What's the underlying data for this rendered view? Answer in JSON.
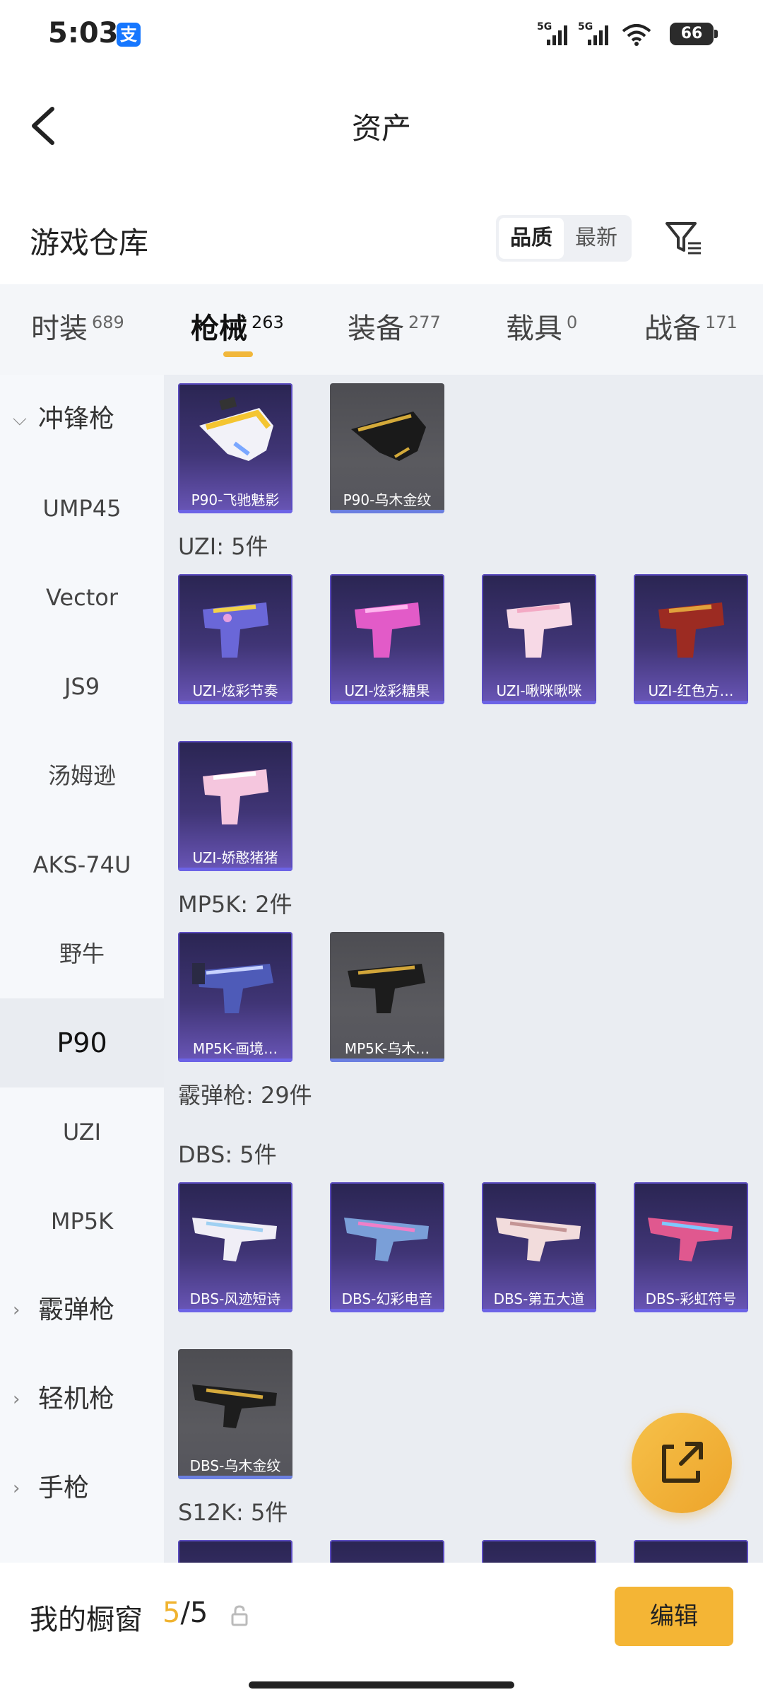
{
  "status": {
    "time": "5:03",
    "alipay_glyph": "支",
    "net1": "5G",
    "net2": "5G",
    "battery": "66"
  },
  "header": {
    "title": "资产"
  },
  "warehouse": {
    "title": "游戏仓库",
    "sort": [
      "品质",
      "最新"
    ],
    "active_sort": 0
  },
  "tabs": [
    {
      "label": "时装",
      "count": "689"
    },
    {
      "label": "枪械",
      "count": "263",
      "active": true
    },
    {
      "label": "装备",
      "count": "277"
    },
    {
      "label": "载具",
      "count": "0"
    },
    {
      "label": "战备",
      "count": "171"
    }
  ],
  "sidebar": [
    {
      "label": "冲锋枪",
      "group": true,
      "chevron": "down"
    },
    {
      "label": "UMP45"
    },
    {
      "label": "Vector"
    },
    {
      "label": "JS9"
    },
    {
      "label": "汤姆逊"
    },
    {
      "label": "AKS-74U"
    },
    {
      "label": "野牛"
    },
    {
      "label": "P90",
      "selected": true
    },
    {
      "label": "UZI"
    },
    {
      "label": "MP5K"
    },
    {
      "label": "霰弹枪",
      "group": true,
      "chevron": "right"
    },
    {
      "label": "轻机枪",
      "group": true,
      "chevron": "right"
    },
    {
      "label": "手枪",
      "group": true,
      "chevron": "right"
    }
  ],
  "sections": {
    "uzi": "UZI: 5件",
    "mp5k": "MP5K: 2件",
    "shotgun": "霰弹枪: 29件",
    "dbs": "DBS: 5件",
    "s12k": "S12K: 5件"
  },
  "cards": {
    "p90": [
      "P90-飞驰魅影",
      "P90-乌木金纹"
    ],
    "uzi": [
      "UZI-炫彩节奏",
      "UZI-炫彩糖果",
      "UZI-啾咪啾咪",
      "UZI-红色方…",
      "UZI-娇憨猪猪"
    ],
    "mp5k": [
      "MP5K-画境…",
      "MP5K-乌木…"
    ],
    "dbs": [
      "DBS-风迹短诗",
      "DBS-幻彩电音",
      "DBS-第五大道",
      "DBS-彩虹符号",
      "DBS-乌木金纹"
    ]
  },
  "bottom": {
    "showcase_label": "我的橱窗",
    "showcase_current": "5",
    "showcase_total": "/5",
    "edit_label": "编辑"
  },
  "colors": {
    "accent": "#f4b535",
    "card_purple": "#403576",
    "card_gold": "#55555c"
  }
}
